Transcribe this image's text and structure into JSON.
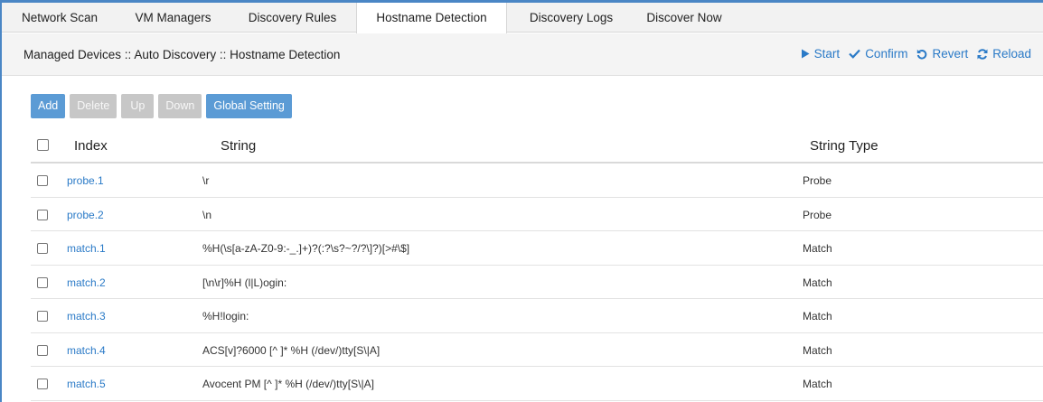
{
  "tabs": [
    {
      "label": "Network Scan",
      "active": false
    },
    {
      "label": "VM Managers",
      "active": false
    },
    {
      "label": "Discovery Rules",
      "active": false
    },
    {
      "label": "Hostname Detection",
      "active": true
    },
    {
      "label": "Discovery Logs",
      "active": false
    },
    {
      "label": "Discover Now",
      "active": false
    }
  ],
  "breadcrumb": "Managed Devices :: Auto Discovery :: Hostname Detection",
  "actions": {
    "start": "Start",
    "confirm": "Confirm",
    "revert": "Revert",
    "reload": "Reload"
  },
  "toolbar": {
    "add": "Add",
    "delete": "Delete",
    "up": "Up",
    "down": "Down",
    "global_setting": "Global Setting"
  },
  "table": {
    "columns": {
      "index": "Index",
      "string": "String",
      "string_type": "String Type"
    },
    "rows": [
      {
        "index": "probe.1",
        "string": "\\r",
        "type": "Probe"
      },
      {
        "index": "probe.2",
        "string": "\\n",
        "type": "Probe"
      },
      {
        "index": "match.1",
        "string": "%H(\\s[a-zA-Z0-9:-_.]+)?(:?\\s?~?/?\\]?)[>#\\$]",
        "type": "Match"
      },
      {
        "index": "match.2",
        "string": "[\\n\\r]%H (l|L)ogin:",
        "type": "Match"
      },
      {
        "index": "match.3",
        "string": "%H!login:",
        "type": "Match"
      },
      {
        "index": "match.4",
        "string": "ACS[v]?6000 [^ ]* %H (/dev/)tty[S\\|A]",
        "type": "Match"
      },
      {
        "index": "match.5",
        "string": "Avocent PM [^ ]* %H (/dev/)tty[S\\|A]",
        "type": "Match"
      }
    ]
  },
  "colors": {
    "accent": "#4a86c5",
    "link": "#2a7ac7",
    "button_primary": "#5b9bd5",
    "button_disabled": "#c7c7c7"
  }
}
